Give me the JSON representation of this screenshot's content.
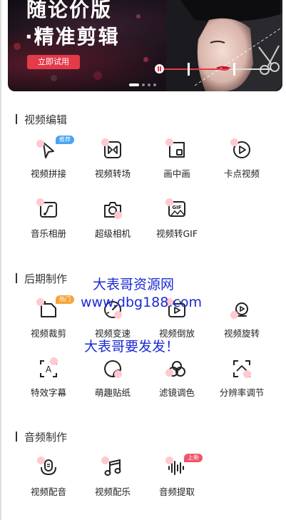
{
  "banner": {
    "title_line1": "随论价版",
    "title_line2": "·精准剪辑",
    "cta_label": "立即试用"
  },
  "sections": [
    {
      "title": "视频编辑",
      "tools": [
        {
          "label": "视频拼接",
          "icon": "cursor-arrow-icon",
          "badge": "推荐"
        },
        {
          "label": "视频转场",
          "icon": "transition-icon",
          "badge": ""
        },
        {
          "label": "画中画",
          "icon": "picture-in-picture-icon",
          "badge": ""
        },
        {
          "label": "卡点视频",
          "icon": "play-circle-icon",
          "badge": ""
        },
        {
          "label": "音乐相册",
          "icon": "music-album-icon",
          "badge": ""
        },
        {
          "label": "超级相机",
          "icon": "camera-icon",
          "badge": ""
        },
        {
          "label": "视频转GIF",
          "icon": "gif-icon",
          "badge": ""
        }
      ]
    },
    {
      "title": "后期制作",
      "tools": [
        {
          "label": "视频裁剪",
          "icon": "crop-icon",
          "badge": "热门"
        },
        {
          "label": "视频变速",
          "icon": "speed-gauge-icon",
          "badge": ""
        },
        {
          "label": "视频倒放",
          "icon": "reverse-icon",
          "badge": ""
        },
        {
          "label": "视频旋转",
          "icon": "rotate-icon",
          "badge": ""
        },
        {
          "label": "特效字幕",
          "icon": "subtitle-icon",
          "badge": ""
        },
        {
          "label": "萌趣贴纸",
          "icon": "sticker-icon",
          "badge": ""
        },
        {
          "label": "滤镜调色",
          "icon": "filter-icon",
          "badge": ""
        },
        {
          "label": "分辨率调节",
          "icon": "resolution-icon",
          "badge": ""
        }
      ]
    },
    {
      "title": "音频制作",
      "tools": [
        {
          "label": "视频配音",
          "icon": "microphone-icon",
          "badge": ""
        },
        {
          "label": "视频配乐",
          "icon": "music-note-icon",
          "badge": ""
        },
        {
          "label": "音频提取",
          "icon": "waveform-icon",
          "badge": "上新"
        }
      ]
    }
  ],
  "watermark": {
    "line1": "大表哥资源网",
    "line2": "www.dbg188.com",
    "line3": "大表哥要发发！"
  },
  "colors": {
    "accent": "#e23b4a",
    "badge_blue": "#4aa3f5",
    "badge_orange": "#f3a43a",
    "badge_red": "#f0556a",
    "icon_pink": "#ffc9d0",
    "watermark": "#1a2bd6"
  }
}
